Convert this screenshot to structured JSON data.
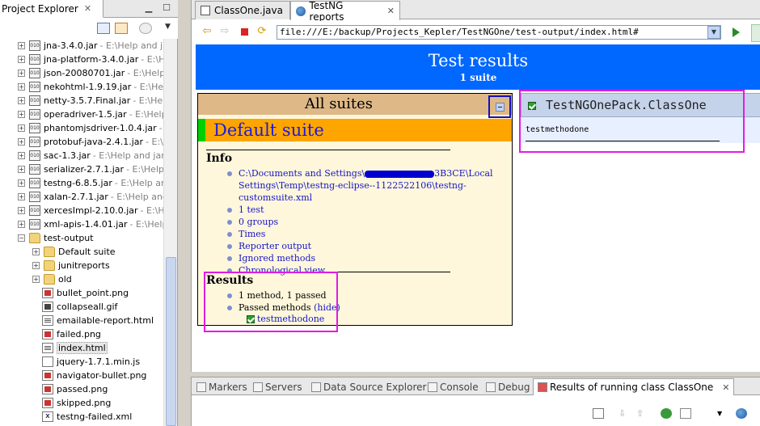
{
  "explorer": {
    "tab_label": "Project Explorer",
    "tree": [
      {
        "type": "jar",
        "name": "jna-3.4.0.jar",
        "path": "- E:\\Help and jar"
      },
      {
        "type": "jar",
        "name": "jna-platform-3.4.0.jar",
        "path": "- E:\\Help"
      },
      {
        "type": "jar",
        "name": "json-20080701.jar",
        "path": "- E:\\Help a"
      },
      {
        "type": "jar",
        "name": "nekohtml-1.9.19.jar",
        "path": "- E:\\Help"
      },
      {
        "type": "jar",
        "name": "netty-3.5.7.Final.jar",
        "path": "- E:\\Help"
      },
      {
        "type": "jar",
        "name": "operadriver-1.5.jar",
        "path": "- E:\\Help a"
      },
      {
        "type": "jar",
        "name": "phantomjsdriver-1.0.4.jar",
        "path": "- E"
      },
      {
        "type": "jar",
        "name": "protobuf-java-2.4.1.jar",
        "path": "- E:\\He"
      },
      {
        "type": "jar",
        "name": "sac-1.3.jar",
        "path": "- E:\\Help and jar fi"
      },
      {
        "type": "jar",
        "name": "serializer-2.7.1.jar",
        "path": "- E:\\Help a"
      },
      {
        "type": "jar",
        "name": "testng-6.8.5.jar",
        "path": "- E:\\Help and"
      },
      {
        "type": "jar",
        "name": "xalan-2.7.1.jar",
        "path": "- E:\\Help and j"
      },
      {
        "type": "jar",
        "name": "xercesImpl-2.10.0.jar",
        "path": "- E:\\Help"
      },
      {
        "type": "jar",
        "name": "xml-apis-1.4.01.jar",
        "path": "- E:\\Help a"
      },
      {
        "type": "folder",
        "name": "test-output",
        "path": "",
        "expanded": true
      },
      {
        "type": "folder",
        "name": "Default suite",
        "path": ""
      },
      {
        "type": "folder",
        "name": "junitreports",
        "path": ""
      },
      {
        "type": "folder",
        "name": "old",
        "path": ""
      },
      {
        "type": "png",
        "name": "bullet_point.png",
        "path": ""
      },
      {
        "type": "gif",
        "name": "collapseall.gif",
        "path": ""
      },
      {
        "type": "html",
        "name": "emailable-report.html",
        "path": ""
      },
      {
        "type": "png",
        "name": "failed.png",
        "path": ""
      },
      {
        "type": "html",
        "name": "index.html",
        "path": "",
        "selected": true
      },
      {
        "type": "js",
        "name": "jquery-1.7.1.min.js",
        "path": ""
      },
      {
        "type": "png",
        "name": "navigator-bullet.png",
        "path": ""
      },
      {
        "type": "png",
        "name": "passed.png",
        "path": ""
      },
      {
        "type": "png",
        "name": "skipped.png",
        "path": ""
      },
      {
        "type": "xml",
        "name": "testng-failed.xml",
        "path": ""
      }
    ]
  },
  "editor": {
    "tabs": [
      {
        "label": "ClassOne.java",
        "active": false
      },
      {
        "label": "TestNG reports",
        "active": true
      }
    ],
    "url": "file:///E:/backup/Projects_Kepler/TestNGOne/test-output/index.html#"
  },
  "report": {
    "title": "Test results",
    "subtitle": "1 suite",
    "all_suites": "All suites",
    "suite_name": "Default suite",
    "info_title": "Info",
    "info_path_part1": "C:\\Documents and Settings\\",
    "info_path_part2": "3B3CE\\Local",
    "info_path_line2": "Settings\\Temp\\testng-eclipse--1122522106\\testng-customsuite.xml",
    "info_links": [
      "1 test",
      "0 groups",
      "Times",
      "Reporter output",
      "Ignored methods",
      "Chronological view"
    ],
    "results_title": "Results",
    "results_summary": "1 method, 1 passed",
    "passed_methods_label": "Passed methods",
    "hide_label": "(hide)",
    "passed_method": "testmethodone",
    "class_name": "TestNGOnePack.ClassOne",
    "class_method": "testmethodone"
  },
  "bottom": {
    "tabs": [
      "Markers",
      "Servers",
      "Data Source Explorer",
      "Console",
      "Debug",
      "Results of running class ClassOne"
    ]
  }
}
